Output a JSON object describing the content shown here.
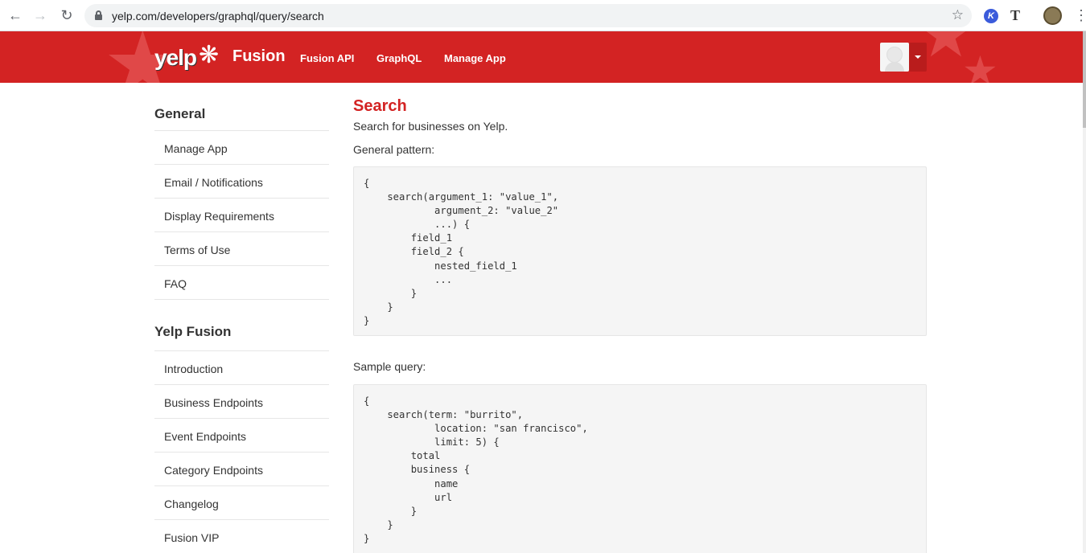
{
  "browser": {
    "url": "yelp.com/developers/graphql/query/search",
    "back_icon": "arrow-left",
    "forward_icon": "arrow-right",
    "reload_icon": "reload",
    "ext_k": "K",
    "ext_t": "T"
  },
  "header": {
    "logo_text": "yelp",
    "brand": "Fusion",
    "nav": [
      "Fusion API",
      "GraphQL",
      "Manage App"
    ],
    "colors": {
      "brand_red": "#d32323"
    }
  },
  "sidebar": {
    "groups": [
      {
        "heading": "General",
        "items": [
          "Manage App",
          "Email / Notifications",
          "Display Requirements",
          "Terms of Use",
          "FAQ"
        ]
      },
      {
        "heading": "Yelp Fusion",
        "items": [
          "Introduction",
          "Business Endpoints",
          "Event Endpoints",
          "Category Endpoints",
          "Changelog",
          "Fusion VIP"
        ]
      }
    ]
  },
  "main": {
    "title": "Search",
    "lead": "Search for businesses on Yelp.",
    "pattern_label": "General pattern:",
    "pattern_code": "{\n    search(argument_1: \"value_1\",\n            argument_2: \"value_2\"\n            ...) {\n        field_1\n        field_2 {\n            nested_field_1\n            ...\n        }\n    }\n}",
    "sample_label": "Sample query:",
    "sample_code": "{\n    search(term: \"burrito\",\n            location: \"san francisco\",\n            limit: 5) {\n        total\n        business {\n            name\n            url\n        }\n    }\n}"
  }
}
